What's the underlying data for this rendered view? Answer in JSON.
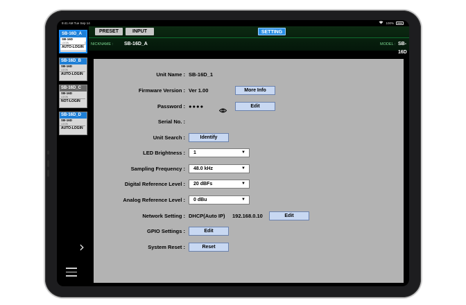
{
  "status_bar": {
    "time": "9:41 AM  Tue Sep 14",
    "battery": "100%"
  },
  "sidebar": {
    "units": [
      {
        "name": "SB-16D_A",
        "model": "SB-16D",
        "login_label": "LOGIN",
        "status": "AUTO-LOGIN",
        "color": "#1e7fd6"
      },
      {
        "name": "SB-16D_B",
        "model": "SB-16D",
        "login_label": "LOGIN",
        "status": "AUTO-LOGIN",
        "color": "#1e7fd6"
      },
      {
        "name": "SB-16D_C",
        "model": "SB-16D",
        "login_label": "LOGIN",
        "status": "NOT-LOGIN",
        "color": "#6a6a6a"
      },
      {
        "name": "SB-16D_D",
        "model": "SB-16D",
        "login_label": "LOGIN",
        "status": "AUTO-LOGIN",
        "color": "#1e7fd6"
      }
    ]
  },
  "header": {
    "tabs": {
      "preset": "PRESET",
      "input": "INPUT",
      "setting": "SETTING"
    },
    "nickname_label": "NICKNAME :",
    "nickname": "SB-16D_A",
    "model_label": "MODEL :",
    "model": "SB-16D"
  },
  "settings": {
    "unit_name": {
      "label": "Unit Name :",
      "value": "SB-16D_1"
    },
    "firmware": {
      "label": "Firmware Version :",
      "value": "Ver 1.00",
      "button": "More Info"
    },
    "password": {
      "label": "Password :",
      "value": "●●●●",
      "button": "Edit"
    },
    "serial": {
      "label": "Serial No. :",
      "value": ""
    },
    "unit_search": {
      "label": "Unit Search :",
      "button": "Identify"
    },
    "led_brightness": {
      "label": "LED Brightness :",
      "selected": "1"
    },
    "sampling": {
      "label": "Sampling Frequency :",
      "selected": "48.0 kHz"
    },
    "digital_ref": {
      "label": "Digital Reference Level :",
      "selected": "20 dBFs"
    },
    "analog_ref": {
      "label": "Analog Reference Level :",
      "selected": "0 dBu"
    },
    "network": {
      "label": "Network Setting :",
      "mode": "DHCP(Auto IP)",
      "ip": "192.168.0.10",
      "button": "Edit"
    },
    "gpio": {
      "label": "GPIO Settings :",
      "button": "Edit"
    },
    "reset": {
      "label": "System Reset :",
      "button": "Reset"
    }
  },
  "icons": {
    "select_arrow": "▼",
    "chevron": "›",
    "eye": "eye-icon",
    "menu": "hamburger-icon"
  }
}
